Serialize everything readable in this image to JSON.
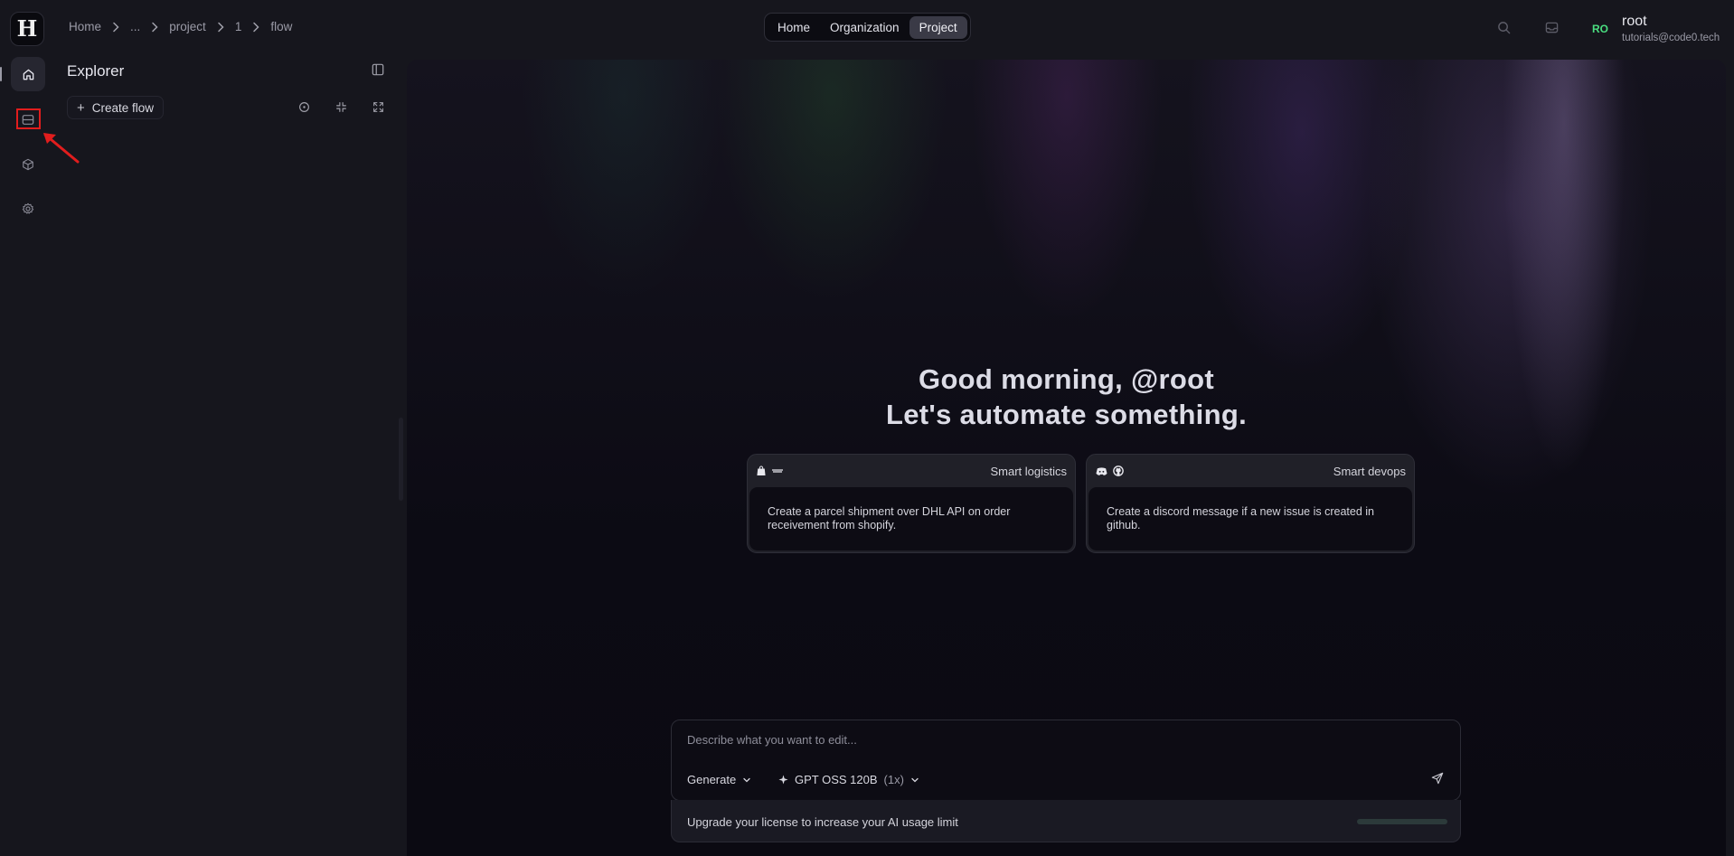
{
  "app": {
    "logo_letter": "H"
  },
  "breadcrumb": [
    "Home",
    "...",
    "project",
    "1",
    "flow"
  ],
  "nav_tabs": {
    "home": "Home",
    "organization": "Organization",
    "project": "Project",
    "active": "Project"
  },
  "user": {
    "initials": "RO",
    "name": "root",
    "email": "tutorials@code0.tech"
  },
  "sidebar": {
    "items": [
      {
        "icon": "home-icon",
        "active": true
      },
      {
        "icon": "flows-icon",
        "active": false,
        "highlighted": true
      },
      {
        "icon": "cube-icon",
        "active": false
      },
      {
        "icon": "gear-icon",
        "active": false
      }
    ]
  },
  "explorer": {
    "title": "Explorer",
    "create_label": "Create flow"
  },
  "main": {
    "greeting_line1": "Good morning, @root",
    "greeting_line2": "Let's automate something.",
    "cards": [
      {
        "label": "Smart logistics",
        "icons": [
          "shopify-icon",
          "dhl-icon"
        ],
        "text": "Create a parcel shipment over DHL API on order receivement from shopify."
      },
      {
        "label": "Smart devops",
        "icons": [
          "discord-icon",
          "github-icon"
        ],
        "text": "Create a discord message if a new issue is created in github."
      }
    ]
  },
  "chat": {
    "placeholder": "Describe what you want to edit...",
    "mode": "Generate",
    "model": "GPT OSS 120B",
    "model_multiplier": "(1x)",
    "upgrade_text": "Upgrade your license to increase your AI usage limit",
    "usage_fraction": 0.0
  },
  "colors": {
    "accent_green": "#4ade80",
    "highlight_red": "#e11d1d"
  }
}
